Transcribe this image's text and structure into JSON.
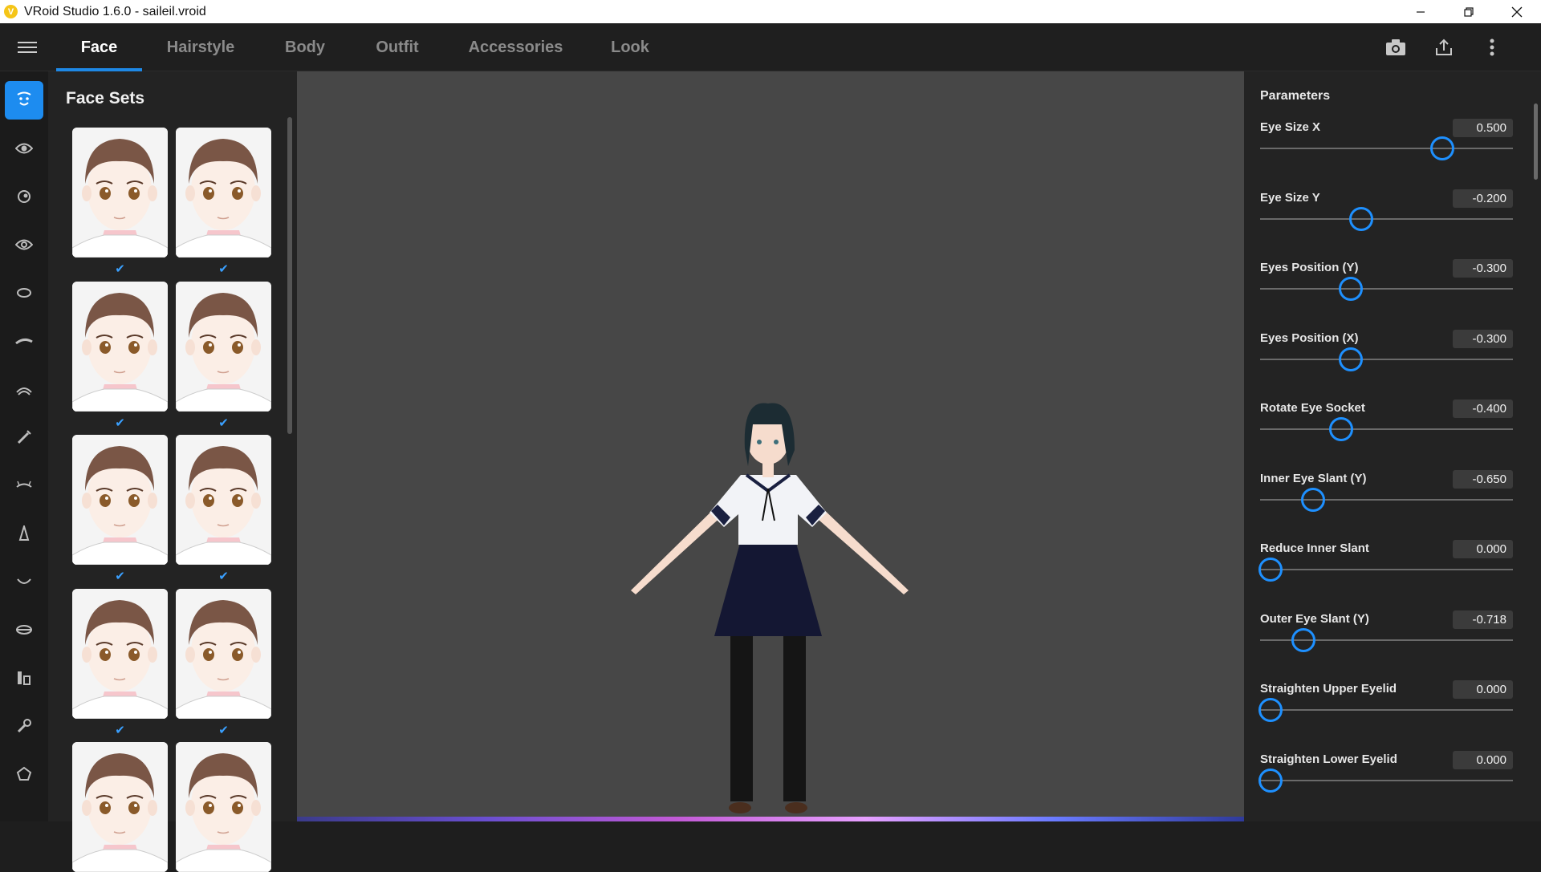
{
  "window": {
    "title": "VRoid Studio 1.6.0 - saileil.vroid",
    "logo_glyph": "V",
    "controls": [
      "minimize",
      "maximize",
      "close"
    ]
  },
  "nav": {
    "tabs": [
      {
        "label": "Face",
        "active": true
      },
      {
        "label": "Hairstyle",
        "active": false
      },
      {
        "label": "Body",
        "active": false
      },
      {
        "label": "Outfit",
        "active": false
      },
      {
        "label": "Accessories",
        "active": false
      },
      {
        "label": "Look",
        "active": false
      }
    ],
    "right_icons": [
      "camera-icon",
      "export-icon",
      "more-vertical-icon"
    ]
  },
  "rail": {
    "items": [
      "face-set-icon",
      "eye-icon",
      "eyeball-icon",
      "iris-icon",
      "eye-outline-icon",
      "eyebrow-icon",
      "eyelash-icon",
      "eyeliner-brush-icon",
      "lower-lash-icon",
      "nose-icon",
      "mouth-icon",
      "lips-icon",
      "teeth-icon",
      "ear-icon",
      "face-shape-icon"
    ],
    "active_index": 0
  },
  "face_sets": {
    "title": "Face Sets",
    "items": [
      {
        "checked": true
      },
      {
        "checked": true
      },
      {
        "checked": true
      },
      {
        "checked": true
      },
      {
        "checked": true
      },
      {
        "checked": true
      },
      {
        "checked": true
      },
      {
        "checked": true
      },
      {
        "checked": false
      },
      {
        "checked": false
      }
    ],
    "check_glyph": "✔"
  },
  "params": {
    "title": "Parameters",
    "items": [
      {
        "label": "Eye Size X",
        "value": "0.500",
        "level": 0.72
      },
      {
        "label": "Eye Size Y",
        "value": "-0.200",
        "level": 0.4
      },
      {
        "label": "Eyes Position (Y)",
        "value": "-0.300",
        "level": 0.36
      },
      {
        "label": "Eyes Position (X)",
        "value": "-0.300",
        "level": 0.36
      },
      {
        "label": "Rotate Eye Socket",
        "value": "-0.400",
        "level": 0.32
      },
      {
        "label": "Inner Eye Slant (Y)",
        "value": "-0.650",
        "level": 0.21
      },
      {
        "label": "Reduce Inner Slant",
        "value": "0.000",
        "level": 0.04
      },
      {
        "label": "Outer Eye Slant (Y)",
        "value": "-0.718",
        "level": 0.17
      },
      {
        "label": "Straighten Upper Eyelid",
        "value": "0.000",
        "level": 0.04
      },
      {
        "label": "Straighten Lower Eyelid",
        "value": "0.000",
        "level": 0.04
      }
    ]
  },
  "colors": {
    "accent": "#1e88e5",
    "slider_thumb": "#1e90ff",
    "check": "#3aa0ff",
    "viewport": "#474747"
  }
}
